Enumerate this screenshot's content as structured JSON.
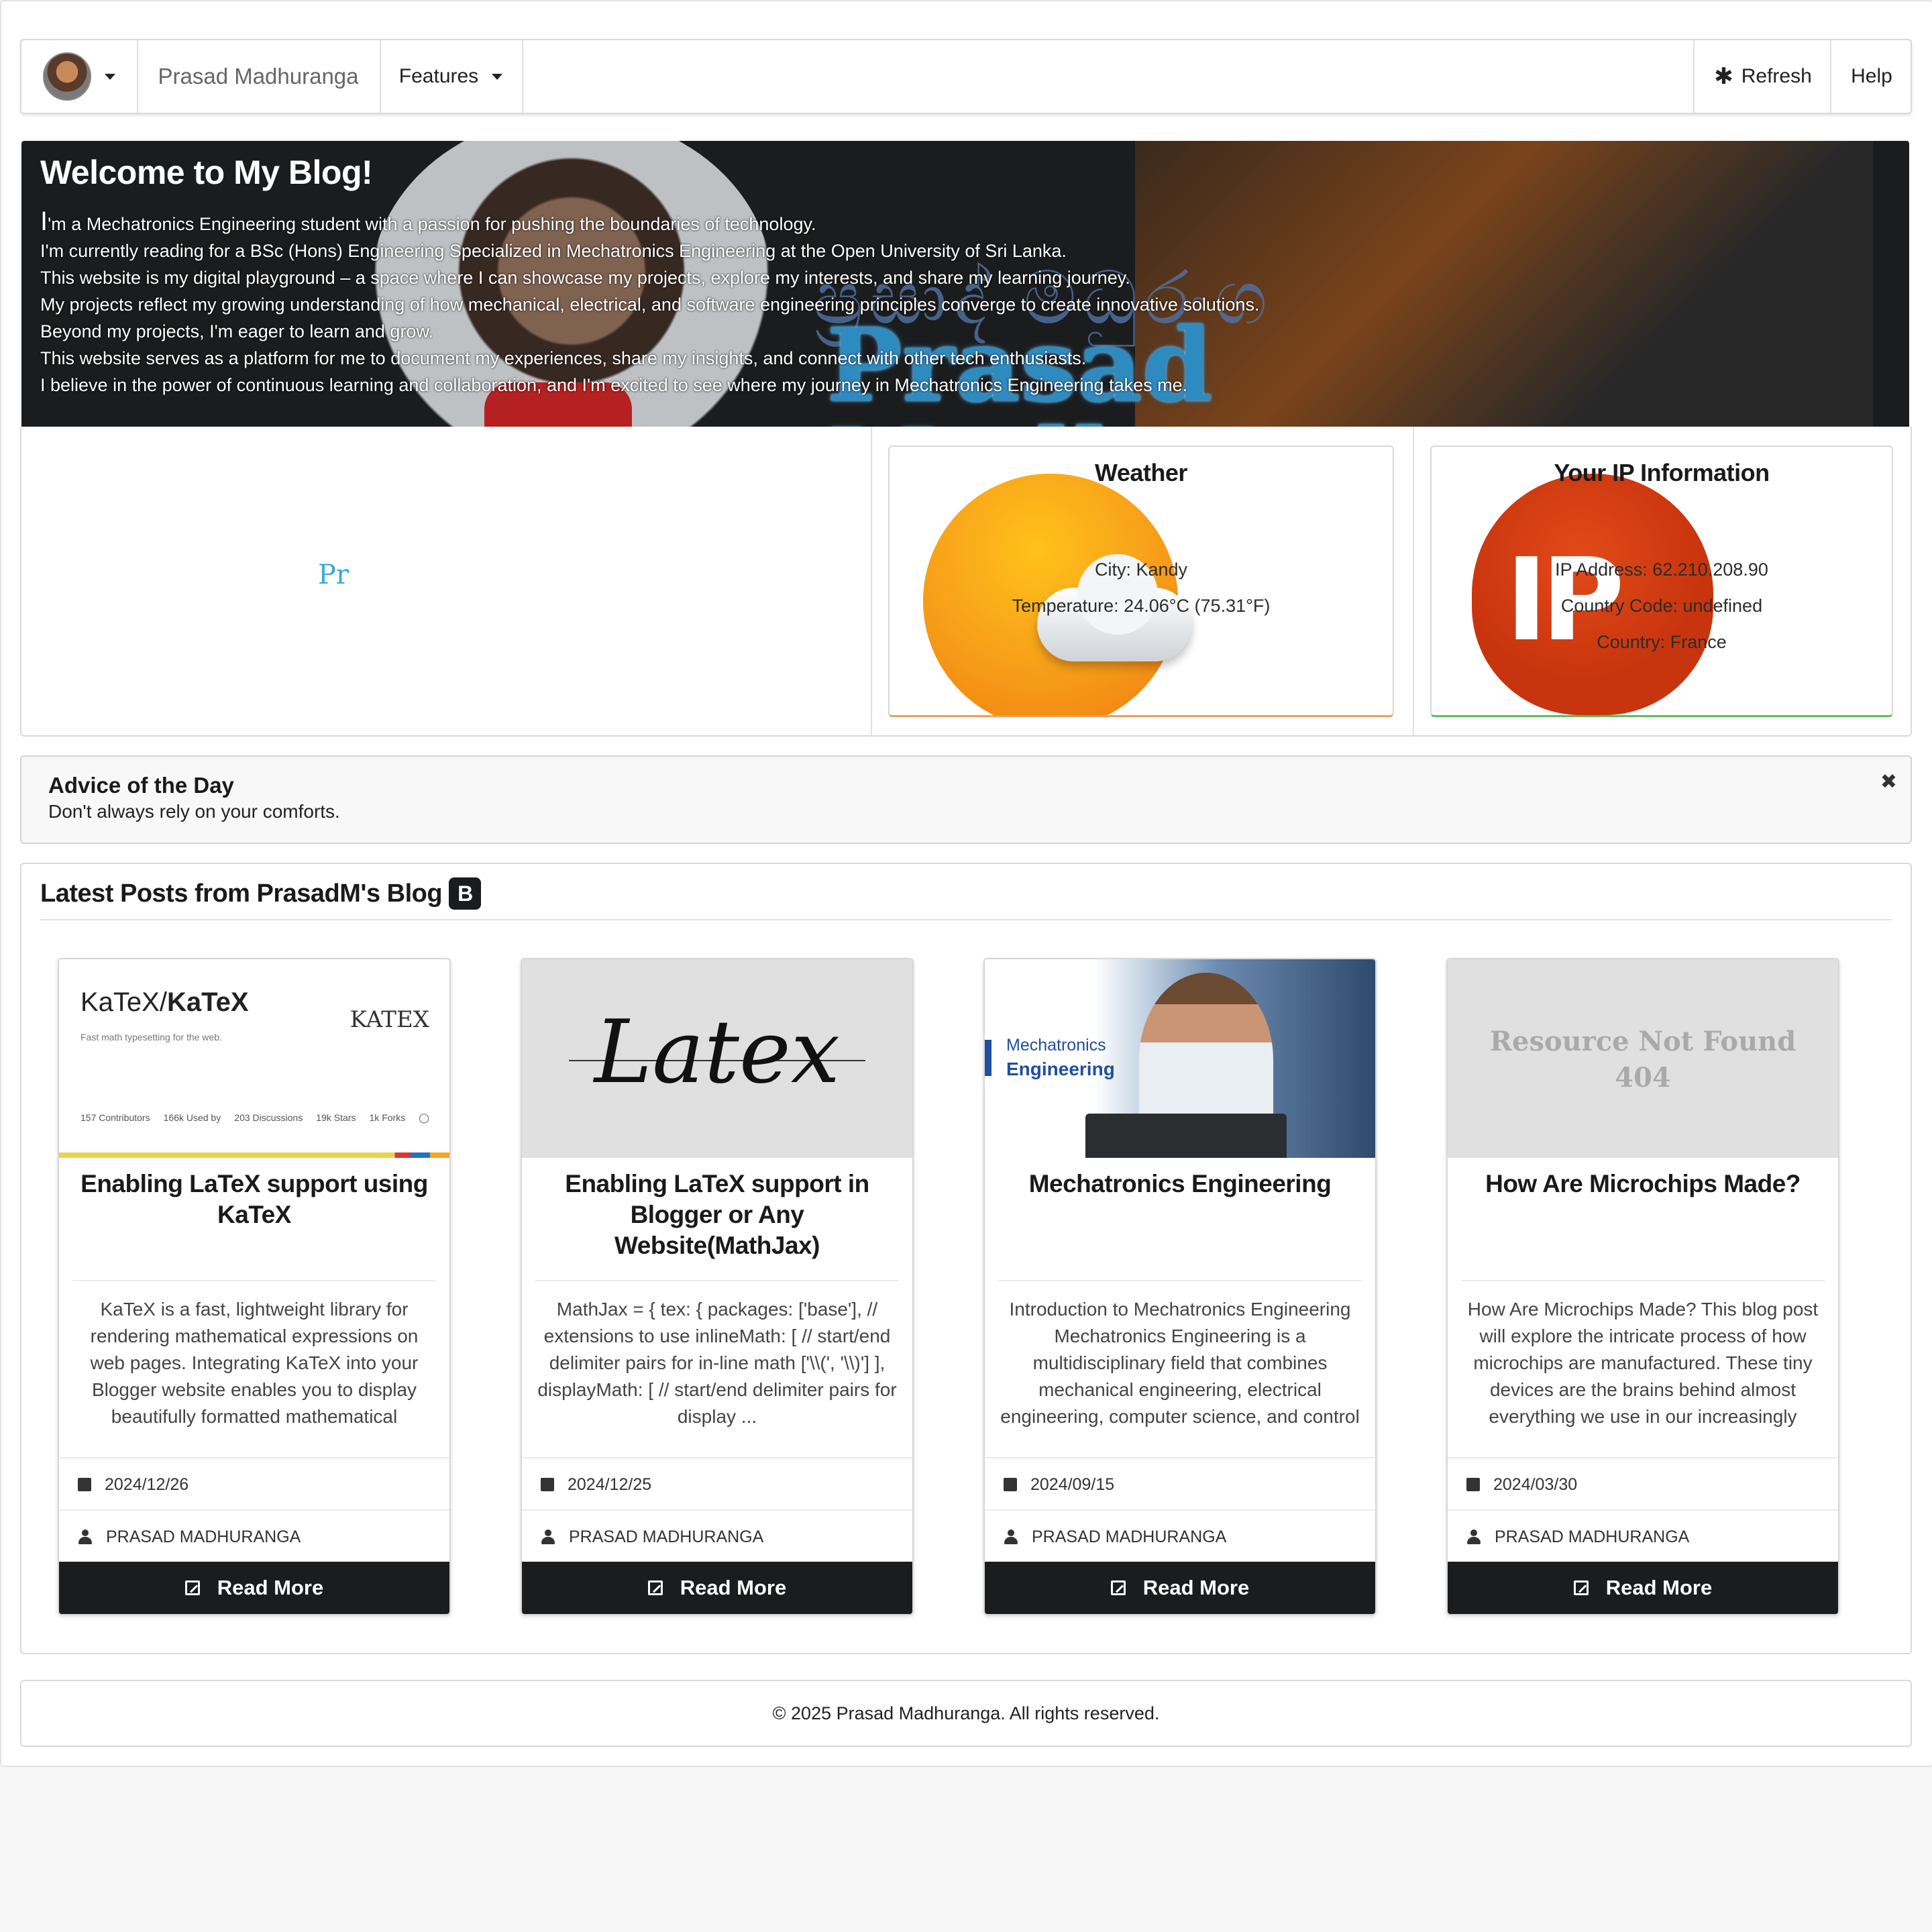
{
  "nav": {
    "brand": "Prasad Madhuranga",
    "features_label": "Features",
    "refresh_label": "Refresh",
    "help_label": "Help"
  },
  "hero": {
    "title": "Welcome to My Blog!",
    "signature_text": "Prasad Madhuranga",
    "intro_first_cap": "I",
    "intro_lines": [
      "'m a Mechatronics Engineering student with a passion for pushing the boundaries of technology.",
      "I'm currently reading for a BSc (Hons) Engineering Specialized in Mechatronics Engineering at the Open University of Sri Lanka.",
      "This website is my digital playground – a space where I can showcase my projects, explore my interests, and share my learning journey.",
      "My projects reflect my growing understanding of how mechanical, electrical, and software engineering principles converge to create innovative solutions.",
      "Beyond my projects, I'm eager to learn and grow.",
      "This website serves as a platform for me to document my experiences, share my insights, and connect with other tech enthusiasts.",
      "I believe in the power of continuous learning and collaboration, and I'm excited to see where my journey in Mechatronics Engineering takes me."
    ]
  },
  "typing_text": "Pr",
  "weather": {
    "title": "Weather",
    "city": "City: Kandy",
    "temperature": "Temperature: 24.06°C (75.31°F)",
    "icon": "sun-cloud-icon"
  },
  "ip": {
    "title": "Your IP Information",
    "address": "IP Address: 62.210.208.90",
    "country_code": "Country Code: undefined",
    "country": "Country: France",
    "icon": "ip-balloon-icon"
  },
  "advice": {
    "heading": "Advice of the Day",
    "text": "Don't always rely on your comforts.",
    "close_icon": "✖"
  },
  "posts": {
    "heading": "Latest Posts from PrasadM's Blog",
    "read_more_label": "Read More",
    "items": [
      {
        "title": "Enabling LaTeX support using KaTeX",
        "description": "KaTeX is a fast, lightweight library for rendering mathematical expressions on web pages. Integrating KaTeX into your Blogger website enables you to display beautifully formatted mathematical expressions and formulas. Below is",
        "date": "2024/12/26",
        "author": "PRASAD MADHURANGA",
        "image": {
          "heading_plain": "KaTeX/",
          "heading_bold": "KaTeX",
          "tagline": "Fast math typesetting for the web.",
          "logo": "KATEX",
          "stats": [
            "157 Contributors",
            "166k Used by",
            "203 Discussions",
            "19k Stars",
            "1k Forks"
          ]
        }
      },
      {
        "title": "Enabling LaTeX support in Blogger or Any Website(MathJax)",
        "description": "MathJax = { tex: { packages: ['base'], // extensions to use inlineMath: [ // start/end delimiter pairs for in-line math ['\\\\(', '\\\\)'] ], displayMath: [ // start/end delimiter pairs for display ...",
        "date": "2024/12/25",
        "author": "PRASAD MADHURANGA",
        "image": {
          "logo": "Latex"
        }
      },
      {
        "title": "Mechatronics Engineering",
        "description": "Introduction to Mechatronics Engineering Mechatronics Engineering is a multidisciplinary field that combines mechanical engineering, electrical engineering, computer science, and control engineering to design and",
        "date": "2024/09/15",
        "author": "PRASAD MADHURANGA",
        "image": {
          "line1": "Mechatronics",
          "line2": "Engineering"
        }
      },
      {
        "title": "How Are Microchips Made?",
        "description": "How Are Microchips Made? This blog post will explore the intricate process of how microchips are manufactured. These tiny devices are the brains behind almost everything we use in our increasingly electronic world, and their production is",
        "date": "2024/03/30",
        "author": "PRASAD MADHURANGA",
        "image": {
          "line1": "Resource Not Found",
          "line2": "404"
        }
      }
    ]
  },
  "footer": {
    "text": "© 2025 Prasad Madhuranga. All rights reserved."
  }
}
